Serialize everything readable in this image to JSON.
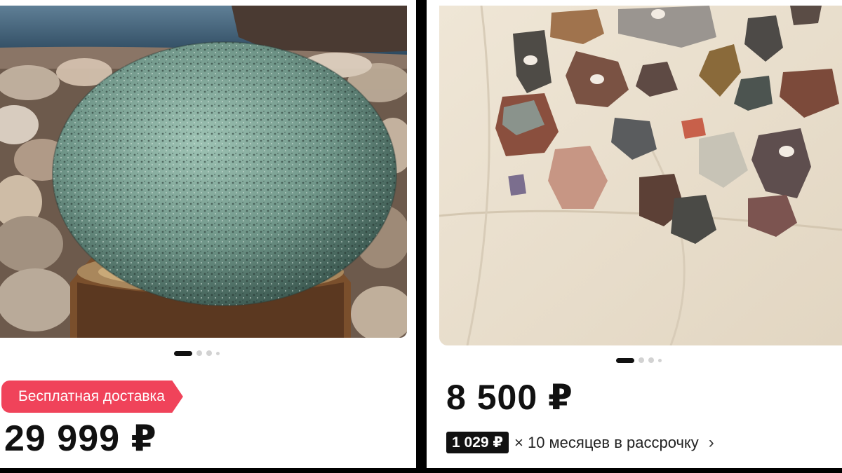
{
  "listings": [
    {
      "badge": "Бесплатная доставка",
      "price": "29 999 ₽",
      "image_alt": "rounded green granite boulder on wooden stand"
    },
    {
      "price": "8 500 ₽",
      "installment": {
        "amount": "1 029 ₽",
        "term": "× 10 месяцев в рассрочку",
        "chevron": "›"
      },
      "image_alt": "collection of rock specimens on white cloth"
    }
  ],
  "carousel": {
    "dot_count": 4,
    "active_index": 0
  },
  "colors": {
    "badge": "#f0435a",
    "price_text": "#111111",
    "installment_tag": "#111111"
  }
}
